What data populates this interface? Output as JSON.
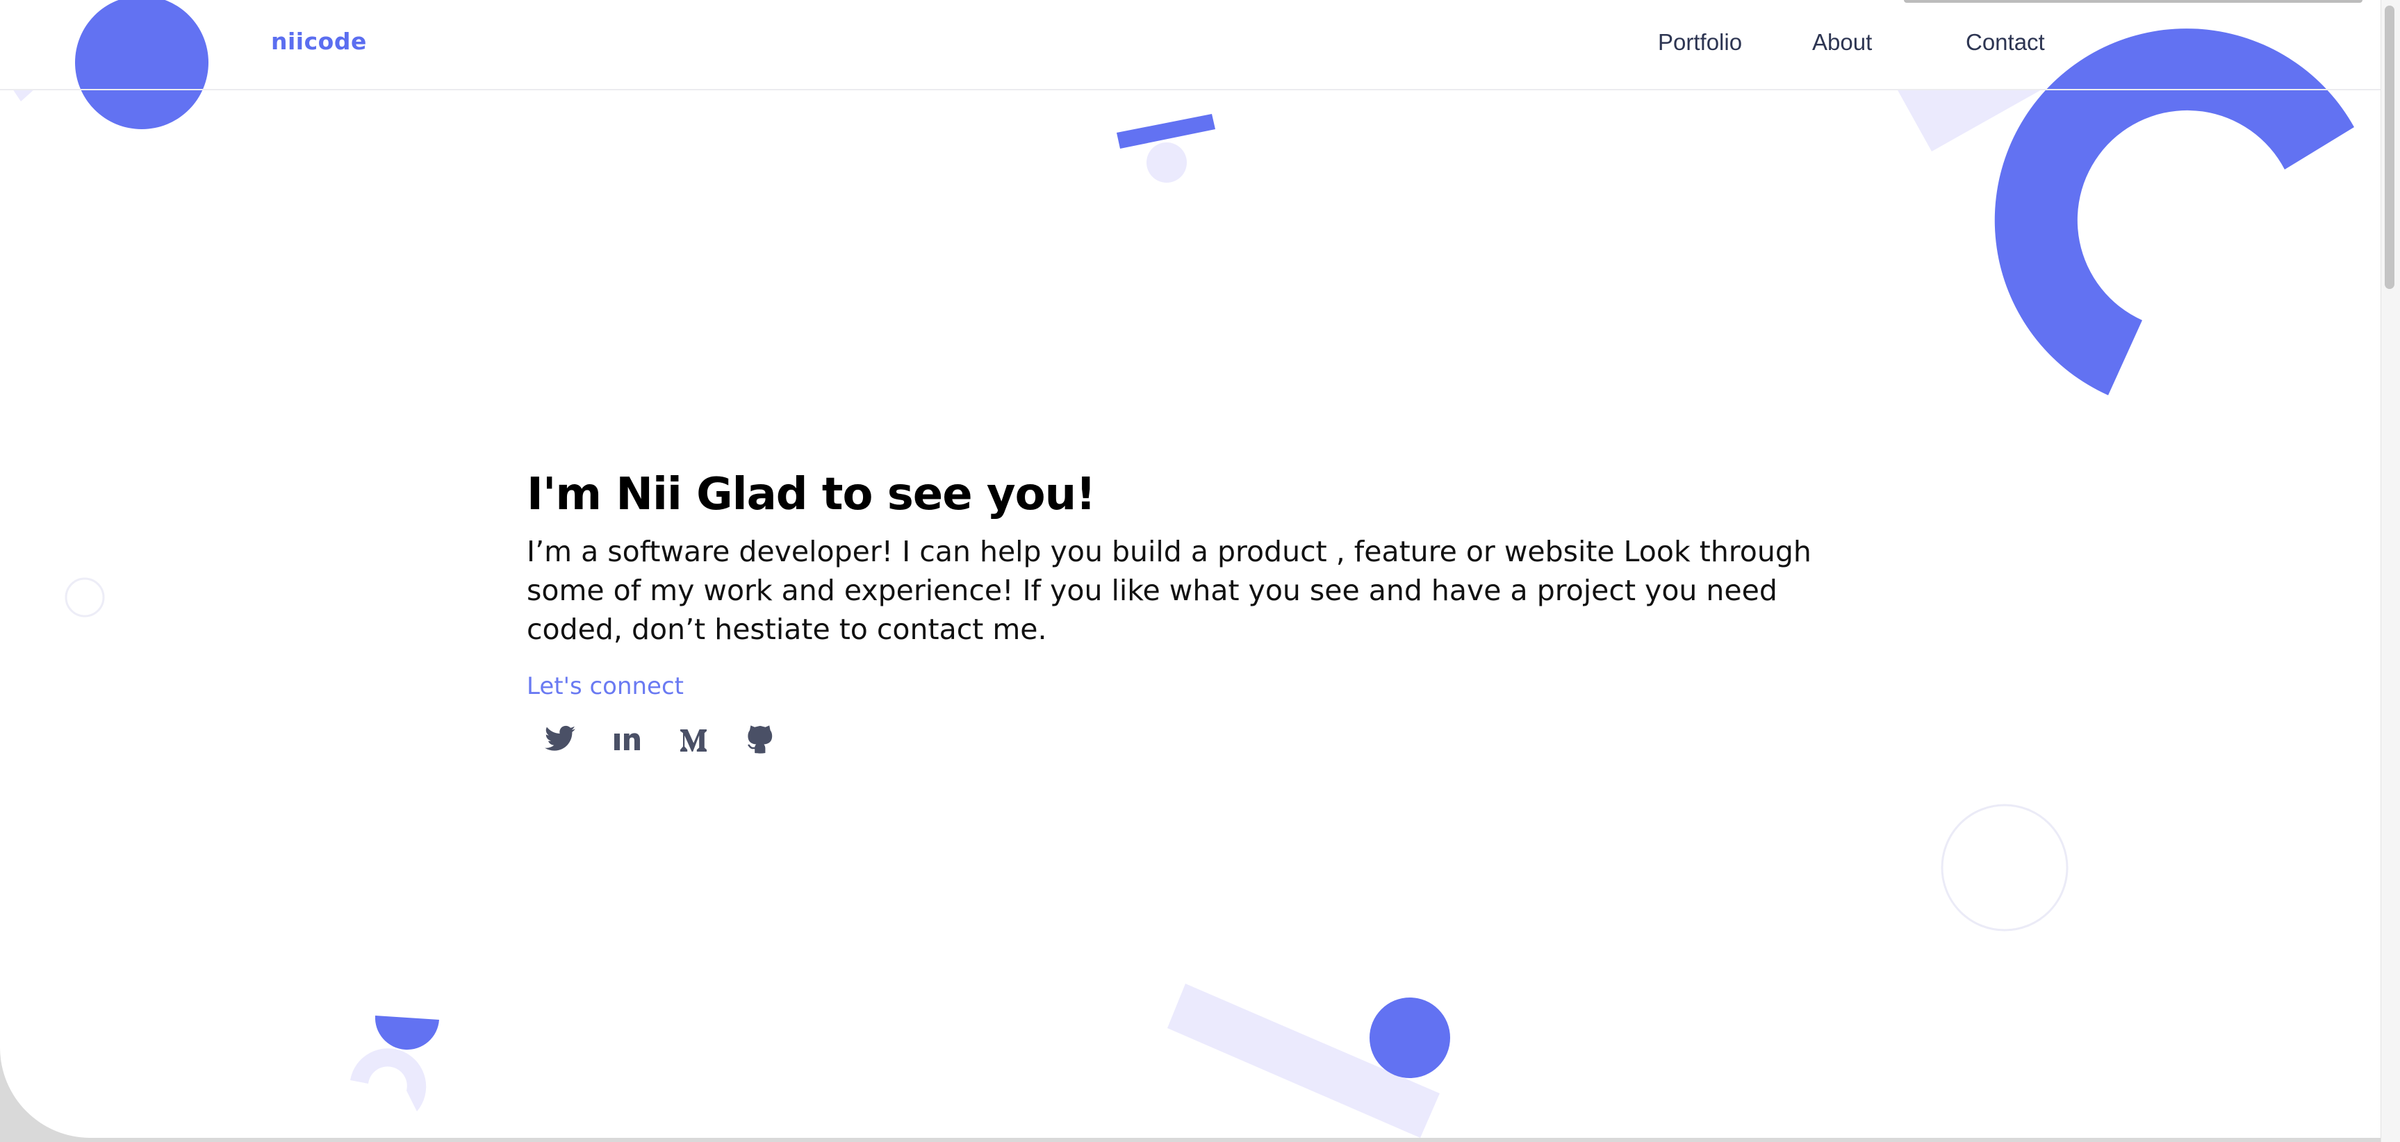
{
  "brand": {
    "logo": "niicode",
    "accent_color": "#6272f2",
    "light_accent_color": "#ebeafd"
  },
  "nav": {
    "items": [
      {
        "label": "Portfolio"
      },
      {
        "label": "About"
      },
      {
        "label": "Contact"
      }
    ]
  },
  "hero": {
    "title": "I'm Nii Glad to see you!",
    "description": "I’m a software developer! I can help you build a product , feature or website Look through some of my work and experience! If you like what you see and have a project you need coded, don’t hestiate to contact me.",
    "connect_label": "Let's connect",
    "socials": [
      {
        "icon": "twitter-icon"
      },
      {
        "icon": "linkedin-icon"
      },
      {
        "icon": "medium-icon"
      },
      {
        "icon": "github-icon"
      }
    ]
  }
}
